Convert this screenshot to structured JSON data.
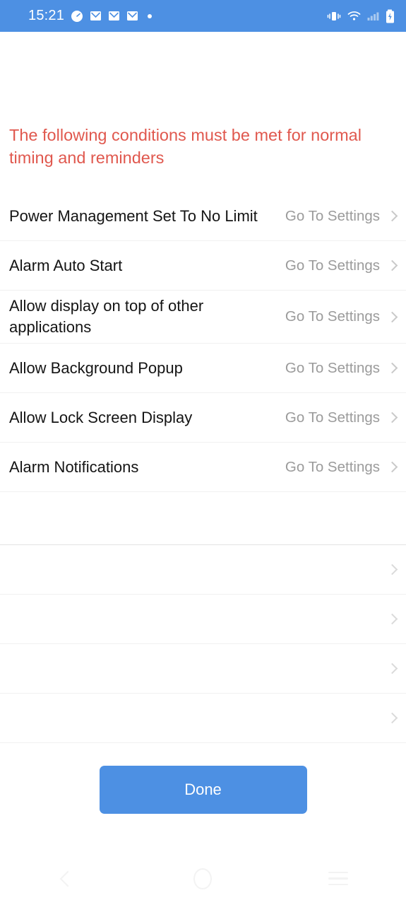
{
  "statusbar": {
    "time": "15:21",
    "left_icons": [
      "clock-icon",
      "mail-icon",
      "mail-icon",
      "mail-icon",
      "dot-indicator"
    ],
    "right_icons": [
      "vibrate-icon",
      "wifi-icon",
      "signal-icon",
      "battery-charging-icon"
    ],
    "background": "#4d90e3"
  },
  "warning": {
    "text": "The following conditions must be met for normal timing and reminders",
    "color": "#e0584e"
  },
  "list": {
    "action_label": "Go To Settings",
    "items": [
      {
        "label": "Power Management Set To No Limit",
        "action": "Go To Settings",
        "lines": 1
      },
      {
        "label": "Alarm Auto Start",
        "action": "Go To Settings",
        "lines": 1
      },
      {
        "label": "Allow display on top of other applications",
        "action": "Go To Settings",
        "lines": 2
      },
      {
        "label": "Allow Background Popup",
        "action": "Go To Settings",
        "lines": 1
      },
      {
        "label": "Allow Lock Screen Display",
        "action": "Go To Settings",
        "lines": 1
      },
      {
        "label": "Alarm Notifications",
        "action": "Go To Settings",
        "lines": 1
      }
    ],
    "empty_rows": [
      {
        "label": "",
        "action": ""
      },
      {
        "label": "",
        "action": ""
      },
      {
        "label": "",
        "action": ""
      },
      {
        "label": "",
        "action": ""
      }
    ]
  },
  "footer": {
    "done_label": "Done",
    "button_color": "#4d90e3"
  },
  "navbar": {
    "back": "back-icon",
    "home": "home-icon",
    "recents": "recents-icon"
  }
}
